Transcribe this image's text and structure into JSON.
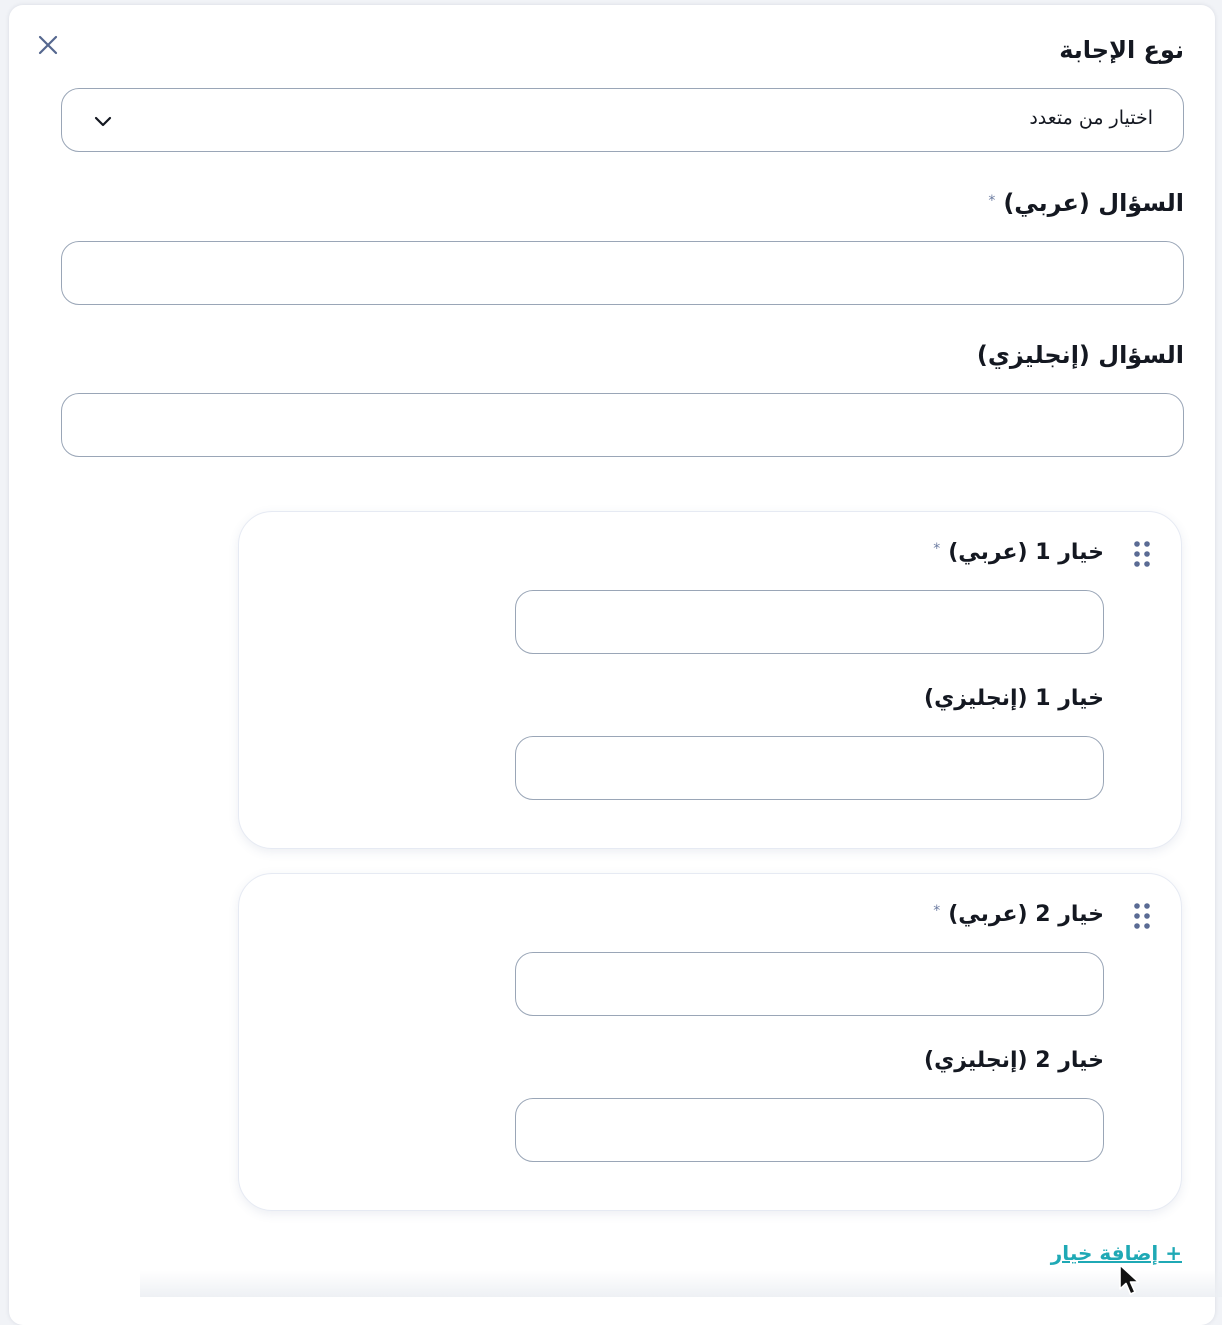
{
  "close": {
    "icon": "close-icon"
  },
  "answer_type": {
    "label": "نوع الإجابة",
    "value": "اختيار من متعدد",
    "icon": "chevron-down-icon"
  },
  "question_ar": {
    "label": "السؤال (عربي)",
    "required_mark": "*",
    "value": ""
  },
  "question_en": {
    "label": "السؤال (إنجليزي)",
    "value": ""
  },
  "options": [
    {
      "ar_label": "خيار 1 (عربي)",
      "ar_required_mark": "*",
      "en_label": "خيار 1 (إنجليزي)",
      "ar_value": "",
      "en_value": ""
    },
    {
      "ar_label": "خيار 2 (عربي)",
      "ar_required_mark": "*",
      "en_label": "خيار 2 (إنجليزي)",
      "ar_value": "",
      "en_value": ""
    }
  ],
  "add_option": {
    "label": "+ إضافة خيار"
  },
  "colors": {
    "accent": "#1fa9b5",
    "border": "#9aa6b7",
    "handle": "#5a6b94",
    "text": "#141821"
  }
}
